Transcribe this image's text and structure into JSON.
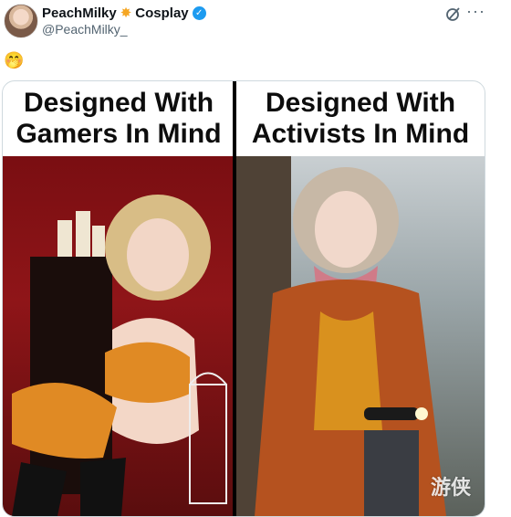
{
  "tweet": {
    "display_name": "PeachMilky",
    "name_suffix": "Cosplay",
    "handle": "@PeachMilky_",
    "text_emoji": "🤭"
  },
  "meme": {
    "left_title_line1": "Designed With",
    "left_title_line2": "Gamers In Mind",
    "right_title_line1": "Designed With",
    "right_title_line2": "Activists In Mind"
  },
  "watermark": {
    "text": "游侠"
  },
  "icons": {
    "star": "star-icon",
    "verified": "verified-badge-icon",
    "grok": "grok-icon",
    "more": "more-options-icon"
  },
  "colors": {
    "verified_blue": "#1d9bf0",
    "handle_gray": "#536471",
    "star_orange": "#f5a623"
  }
}
